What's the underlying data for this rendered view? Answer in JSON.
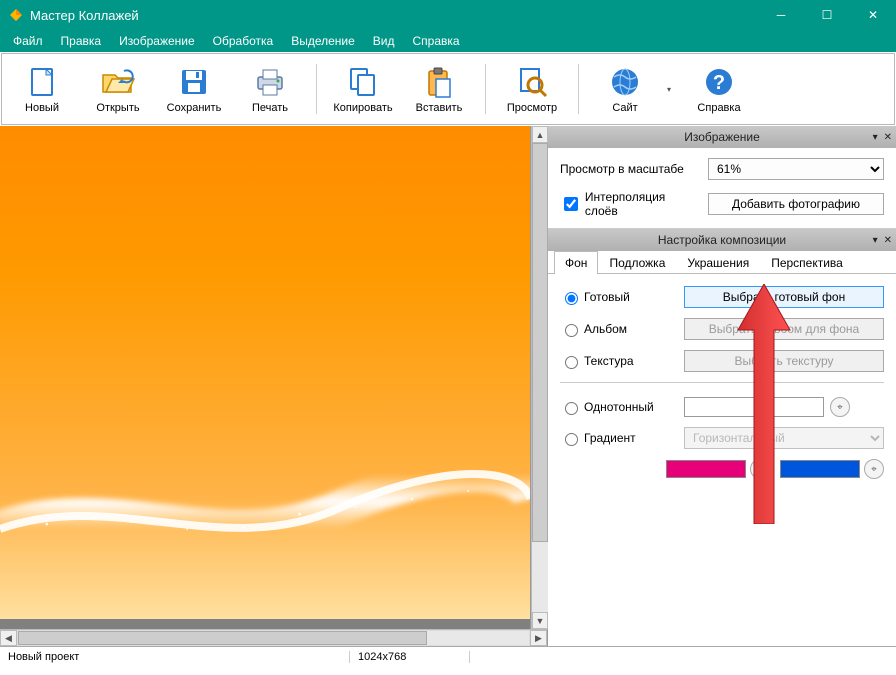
{
  "window": {
    "title": "Мастер Коллажей"
  },
  "menu": [
    "Файл",
    "Правка",
    "Изображение",
    "Обработка",
    "Выделение",
    "Вид",
    "Справка"
  ],
  "toolbar": {
    "new": "Новый",
    "open": "Открыть",
    "save": "Сохранить",
    "print": "Печать",
    "copy": "Копировать",
    "paste": "Вставить",
    "view": "Просмотр",
    "site": "Сайт",
    "help": "Справка"
  },
  "panel_image": {
    "title": "Изображение",
    "scale_label": "Просмотр в масштабе",
    "scale_value": "61%",
    "interpolate": "Интерполяция слоёв",
    "add_photo": "Добавить фотографию"
  },
  "panel_composition": {
    "title": "Настройка композиции",
    "tabs": [
      "Фон",
      "Подложка",
      "Украшения",
      "Перспектива"
    ],
    "active_tab": 0,
    "opt_ready": "Готовый",
    "btn_ready": "Выбрать готовый фон",
    "opt_album": "Альбом",
    "btn_album": "Выбрать альбом для фона",
    "opt_texture": "Текстура",
    "btn_texture": "Выбрать текстуру",
    "opt_solid": "Однотонный",
    "opt_gradient": "Градиент",
    "gradient_type": "Горизонтальный",
    "color1": "#e6007a",
    "color2": "#0055dd"
  },
  "status": {
    "project": "Новый проект",
    "dimensions": "1024x768"
  },
  "accent_color": "#009688"
}
